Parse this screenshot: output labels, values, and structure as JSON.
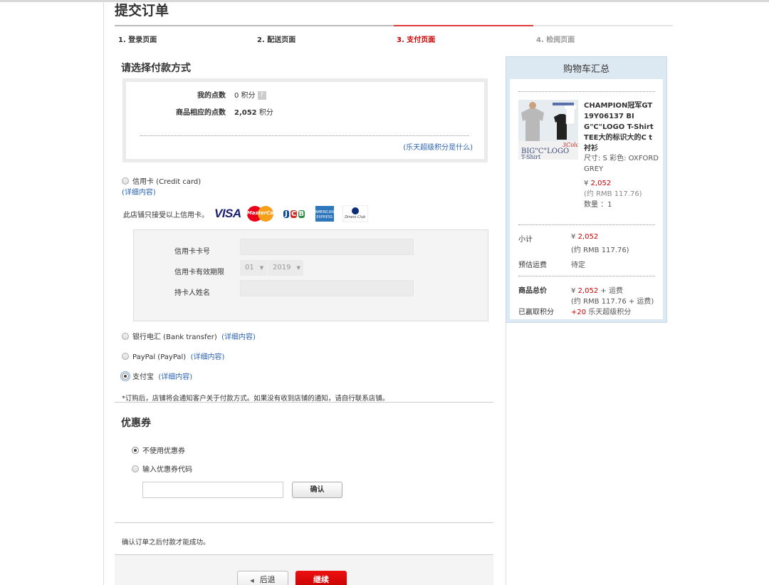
{
  "page": {
    "title": "提交订单"
  },
  "steps": [
    {
      "label": "1. 登录页面",
      "state": "done"
    },
    {
      "label": "2. 配送页面",
      "state": "done"
    },
    {
      "label": "3. 支付页面",
      "state": "active"
    },
    {
      "label": "4. 检阅页面",
      "state": "future"
    }
  ],
  "payment": {
    "section_title": "请选择付款方式",
    "points": {
      "my_points_label": "我的点数",
      "my_points_value": "0 积分",
      "product_points_label": "商品相应的点数",
      "product_points_value": "2,052",
      "product_points_unit": "积分",
      "help_icon": "question-mark-icon",
      "what_link": "(乐天超级积分是什么)"
    },
    "methods": [
      {
        "label": "信用卡 (Credit card)",
        "detail_link": "(详细内容)",
        "selected": false
      },
      {
        "label": "银行电汇 (Bank transfer)",
        "detail_link": "(详细内容)",
        "selected": false
      },
      {
        "label": "PayPal (PayPal)",
        "detail_link": "(详细内容)",
        "selected": false
      },
      {
        "label": "支付宝",
        "detail_link": "(详细内容)",
        "selected": true
      }
    ],
    "accepted_cards_text": "此店铺只接受以上信用卡。",
    "card_brands": [
      "VISA",
      "MasterCard",
      "JCB",
      "American Express",
      "Diners Club International"
    ],
    "credit_form": {
      "card_number_label": "信用卡卡号",
      "card_number_value": "",
      "expiry_label": "信用卡有效期限",
      "expiry_month": "01",
      "expiry_year": "2019",
      "holder_label": "持卡人姓名",
      "holder_value": ""
    },
    "note": "*订购后，店铺将会通知客户关于付款方式。如果没有收到店铺的通知，请自行联系店铺。"
  },
  "coupon": {
    "section_title": "优惠券",
    "options": [
      {
        "label": "不使用优惠券",
        "selected": true
      },
      {
        "label": "输入优惠券代码",
        "selected": false
      }
    ],
    "code_value": "",
    "confirm_label": "确认"
  },
  "footer": {
    "confirm_note": "确认订单之后付款才能成功。",
    "back_label": "后退",
    "next_label": "继续"
  },
  "cart": {
    "title": "购物车汇总",
    "product": {
      "name": "CHAMPION冠军GT19Y06137 BIG\"C\"LOGO T-Shirt TEE大的标识大的C t衬衫",
      "image_caption": "BIG \"C\" LOGO T-Shirt",
      "image_subcaption": "3Color",
      "size_color": "尺寸: S 彩色: OXFORD GREY",
      "price_symbol": "¥",
      "price": "2,052",
      "price_rmb": "(约 RMB 117.76)",
      "quantity": "数量 ：1"
    },
    "subtotal_label": "小计",
    "subtotal_symbol": "¥",
    "subtotal_value": "2,052",
    "subtotal_rmb": "(约 RMB 117.76)",
    "shipping_label": "预估运费",
    "shipping_value": "待定",
    "total_label": "商品总价",
    "total_symbol": "¥",
    "total_value": "2,052",
    "total_suffix": "+ 运费",
    "total_rmb": "(约 RMB 117.76 + 运费)",
    "earned_label": "已赢取积分",
    "earned_value": "+20",
    "earned_unit": "乐天超级积分"
  },
  "colors": {
    "accent_red": "#cc0000",
    "link_blue": "#2a63b1",
    "cart_bg": "#dde9f2"
  }
}
